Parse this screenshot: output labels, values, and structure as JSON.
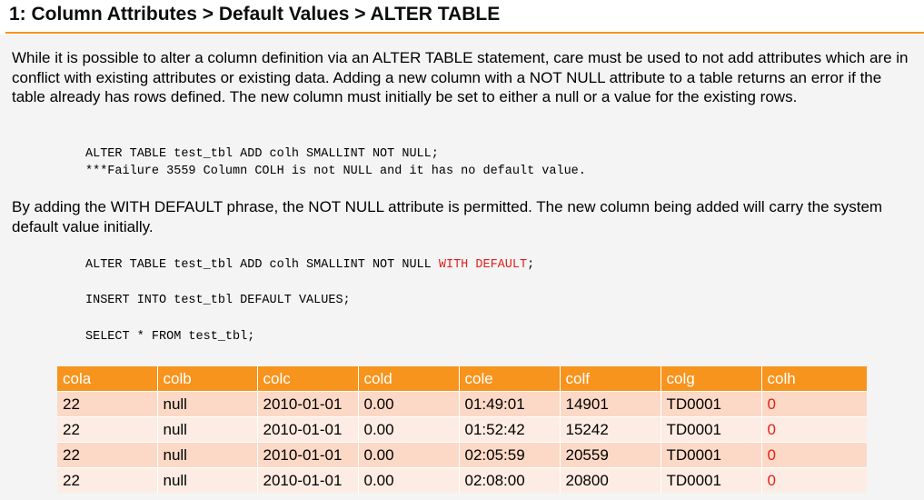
{
  "header": {
    "title": "1: Column Attributes > Default Values > ALTER TABLE"
  },
  "paragraphs": {
    "p1": "While it is possible to alter a column definition via an ALTER TABLE statement, care must be used to not add attributes which are in conflict with existing attributes or existing data. Adding a new column with a NOT NULL attribute to a table returns an error if the table already has rows defined. The new column must initially be set to either a null or a value for the existing rows.",
    "p2": "By adding the WITH DEFAULT phrase, the NOT NULL attribute is permitted. The new column being added will carry the system default value initially."
  },
  "code": {
    "line1": "ALTER TABLE test_tbl ADD colh SMALLINT NOT NULL;",
    "line2": "***Failure 3559 Column COLH is not NULL and it has no default value.",
    "line3_prefix": "ALTER TABLE test_tbl ADD colh SMALLINT NOT NULL ",
    "line3_highlight": "WITH DEFAULT",
    "line3_suffix": ";",
    "line4": "INSERT INTO test_tbl DEFAULT VALUES;",
    "line5": "SELECT * FROM test_tbl;"
  },
  "table": {
    "headers": [
      "cola",
      "colb",
      "colc",
      "cold",
      "cole",
      "colf",
      "colg",
      "colh"
    ],
    "rows": [
      [
        "22",
        "null",
        "2010-01-01",
        "0.00",
        "01:49:01",
        "14901",
        "TD0001",
        "0"
      ],
      [
        "22",
        "null",
        "2010-01-01",
        "0.00",
        "01:52:42",
        "15242",
        "TD0001",
        "0"
      ],
      [
        "22",
        "null",
        "2010-01-01",
        "0.00",
        "02:05:59",
        "20559",
        "TD0001",
        "0"
      ],
      [
        "22",
        "null",
        "2010-01-01",
        "0.00",
        "02:08:00",
        "20800",
        "TD0001",
        "0"
      ]
    ]
  },
  "colors": {
    "accent": "#f7941d",
    "highlight_red": "#e0201b",
    "row_odd": "#fbd9c6",
    "row_even": "#fdece3"
  }
}
